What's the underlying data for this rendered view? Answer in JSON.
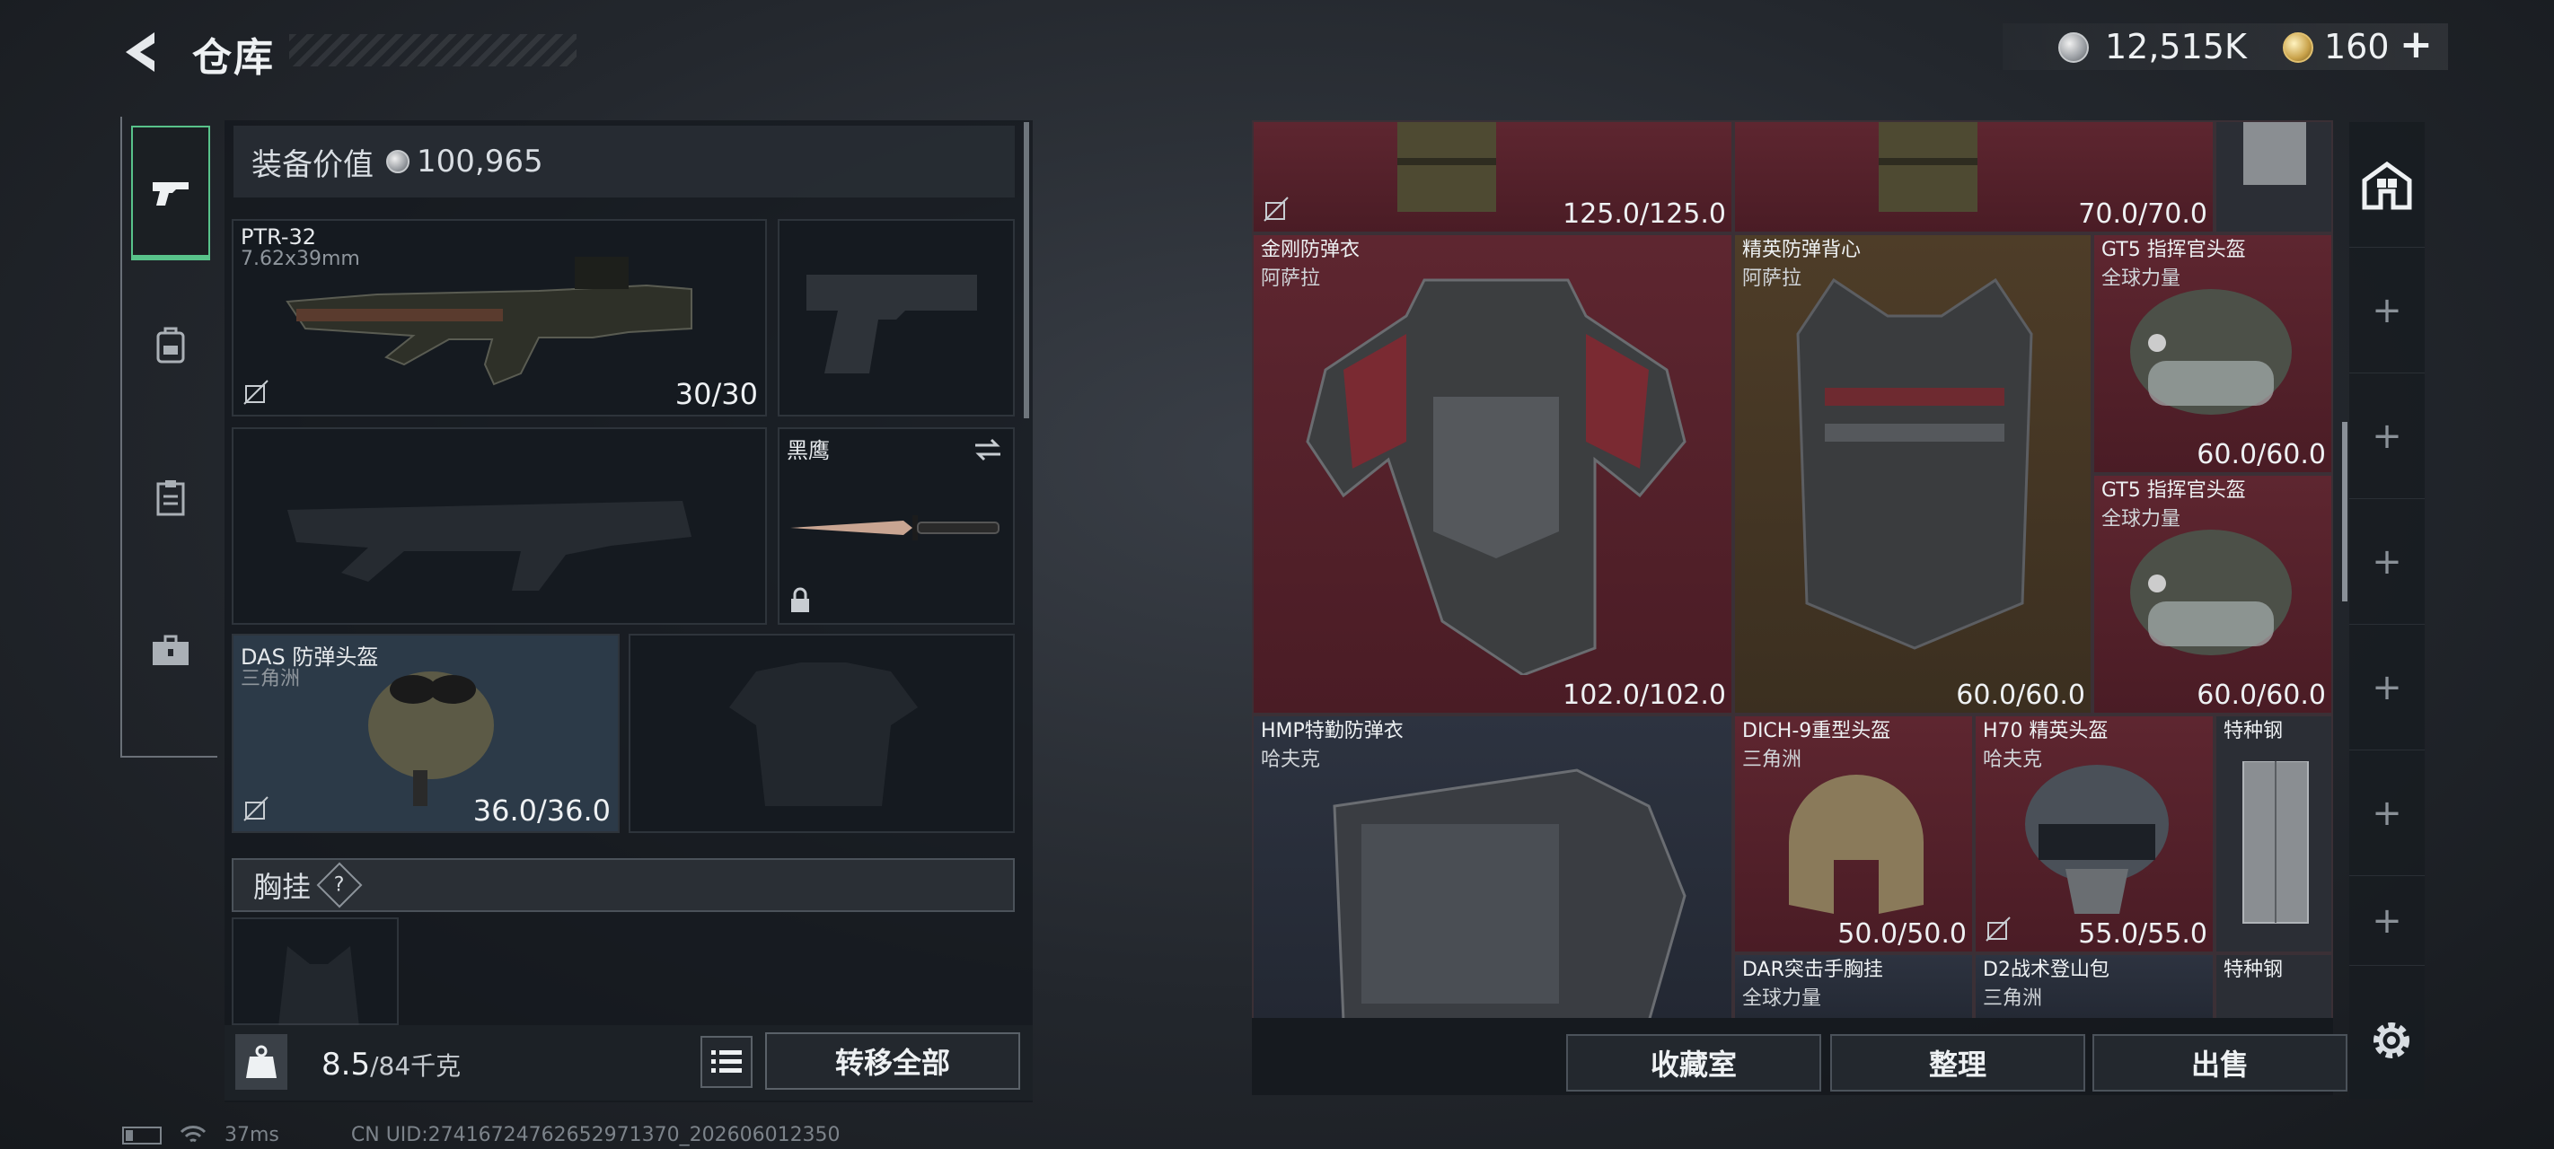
{
  "header": {
    "title": "仓库",
    "currency": [
      {
        "icon": "silver-coin-icon",
        "value": "12,515K"
      },
      {
        "icon": "gold-coin-icon",
        "value": "160"
      }
    ],
    "add_currency_label": "+"
  },
  "loadout": {
    "equip_value_label": "装备价值",
    "equip_value": "100,965",
    "primary_weapon": {
      "name": "PTR-32",
      "caliber": "7.62x39mm",
      "ammo": "30/30"
    },
    "knife": {
      "name": "黑鹰"
    },
    "helmet": {
      "name": "DAS 防弹头盔",
      "brand": "三角洲",
      "durability": "36.0/36.0"
    },
    "chest_rig_label": "胸挂",
    "chest_rig_help": "?",
    "weight_value": "8.5",
    "weight_capacity": "/84千克",
    "transfer_all_label": "转移全部"
  },
  "storage": {
    "items": [
      {
        "key": "top1",
        "durability": "125.0/125.0"
      },
      {
        "key": "top2",
        "durability": "70.0/70.0"
      },
      {
        "key": "jg",
        "name": "金刚防弹衣",
        "brand": "阿萨拉",
        "durability": "102.0/102.0"
      },
      {
        "key": "jy",
        "name": "精英防弹背心",
        "brand": "阿萨拉",
        "durability": "60.0/60.0"
      },
      {
        "key": "gt5a",
        "name": "GT5 指挥官头盔",
        "brand": "全球力量",
        "durability": "60.0/60.0"
      },
      {
        "key": "gt5b",
        "name": "GT5 指挥官头盔",
        "brand": "全球力量",
        "durability": "60.0/60.0"
      },
      {
        "key": "hmp",
        "name": "HMP特勤防弹衣",
        "brand": "哈夫克"
      },
      {
        "key": "dich",
        "name": "DICH-9重型头盔",
        "brand": "三角洲",
        "durability": "50.0/50.0"
      },
      {
        "key": "h70",
        "name": "H70 精英头盔",
        "brand": "哈夫克",
        "durability": "55.0/55.0"
      },
      {
        "key": "steel1",
        "name": "特种钢"
      },
      {
        "key": "dar",
        "name": "DAR突击手胸挂",
        "brand": "全球力量"
      },
      {
        "key": "d2",
        "name": "D2战术登山包",
        "brand": "三角洲"
      },
      {
        "key": "steel2",
        "name": "特种钢"
      }
    ]
  },
  "actions": {
    "collection_label": "收藏室",
    "sort_label": "整理",
    "sell_label": "出售"
  },
  "sidebar": {
    "add_labels": [
      "+",
      "+",
      "+",
      "+",
      "+",
      "+",
      "+"
    ]
  },
  "status": {
    "ping": "37ms",
    "uid": "CN UID:274167247626529713​70_202606012350"
  }
}
